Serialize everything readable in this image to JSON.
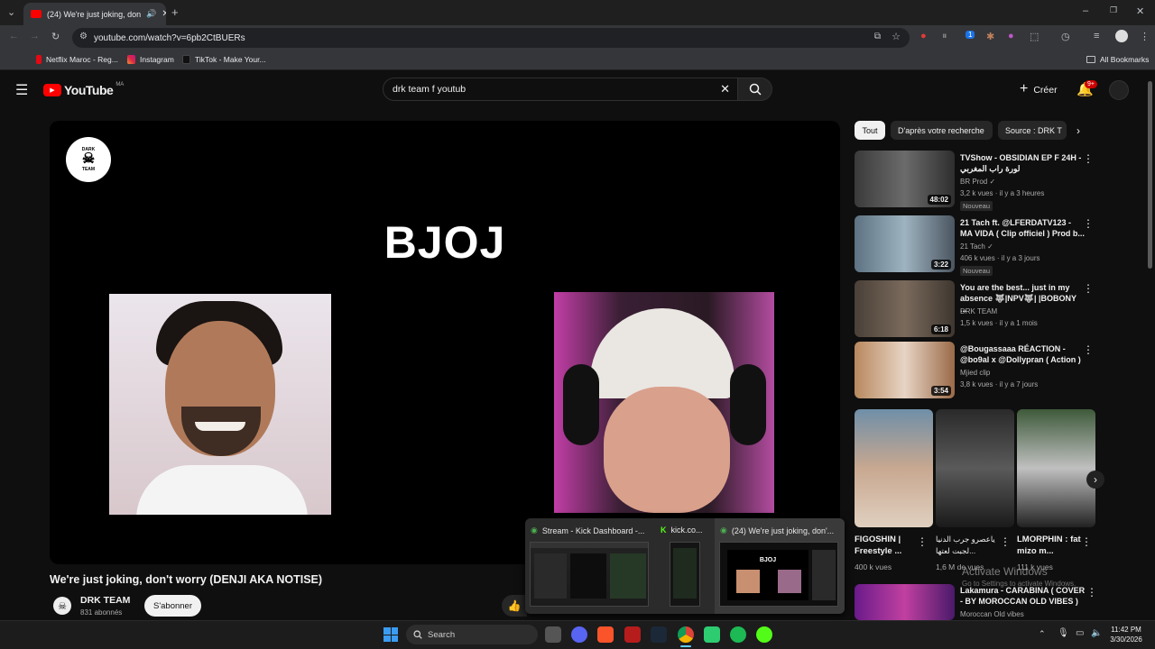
{
  "browser": {
    "tab_title": "(24) We're just joking, don",
    "url": "youtube.com/watch?v=6pb2CtBUERs",
    "bookmarks": [
      "Netflix Maroc - Reg...",
      "Instagram",
      "TikTok - Make Your..."
    ],
    "all_bookmarks": "All Bookmarks",
    "tab_badge": "1"
  },
  "header": {
    "logo": "YouTube",
    "country": "MA",
    "search_value": "drk team f youtub",
    "create_label": "Créer",
    "notif_count": "9+"
  },
  "video": {
    "overlay_title": "BJOJ",
    "logo_text_top": "DARK",
    "logo_text_bottom": "TEAM",
    "title": "We're just joking, don't worry (DENJI AKA NOTISE)",
    "channel": "DRK TEAM",
    "subscribers": "831 abonnés",
    "subscribe_label": "S'abonner"
  },
  "chips": [
    "Tout",
    "D'après votre recherche",
    "Source : DRK T"
  ],
  "recommendations": [
    {
      "title": "TVShow - OBSIDIAN EP F 24H - لورة راب المغربي",
      "channel": "BR Prod",
      "meta": "3,2 k vues · il y a 3 heures",
      "duration": "48:02",
      "badge": "Nouveau"
    },
    {
      "title": "21 Tach ft. @LFERDATV123 - MA VIDA ( Clip officiel ) Prod b...",
      "channel": "21 Tach",
      "meta": "406 k vues · il y a 3 jours",
      "duration": "3:22",
      "badge": "Nouveau"
    },
    {
      "title": "You are the best... just in my absence 🐺|NPV🐺| |BOBONY ...",
      "channel": "DRK TEAM",
      "meta": "1,5 k vues · il y a 1 mois",
      "duration": "6:18",
      "badge": ""
    },
    {
      "title": "@Bougassaaa  RÉACTION - @bo9al  x @Dollypran  ( Action )",
      "channel": "Mjied clip",
      "meta": "3,8 k vues · il y a 7 jours",
      "duration": "3:54",
      "badge": ""
    }
  ],
  "shorts": [
    {
      "title": "FIGOSHIN | Freestyle ...",
      "views": "400 k vues"
    },
    {
      "title": "ياعصرو جرب الدنيا لجبت لعتها...",
      "views": "1,6 M de vues"
    },
    {
      "title": "LMORPHIN : fat mizo m...",
      "views": "111 k vues"
    }
  ],
  "next_video": {
    "title": "Lakamura - CARABINA ( COVER - BY MOROCCAN OLD VIBES )",
    "channel": "Moroccan Old vibes"
  },
  "watermark": {
    "line1": "Activate Windows",
    "line2": "Go to Settings to activate Windows."
  },
  "taskbar_preview": {
    "windows": [
      "Stream - Kick Dashboard -...",
      "kick.co...",
      "(24) We're just joking, don'..."
    ],
    "mini_title": "BJOJ"
  },
  "taskbar": {
    "search_placeholder": "Search",
    "time": "11:42 PM",
    "date": "3/30/2026"
  },
  "colors": {
    "youtube_red": "#ff0000",
    "background": "#0f0f0f"
  }
}
